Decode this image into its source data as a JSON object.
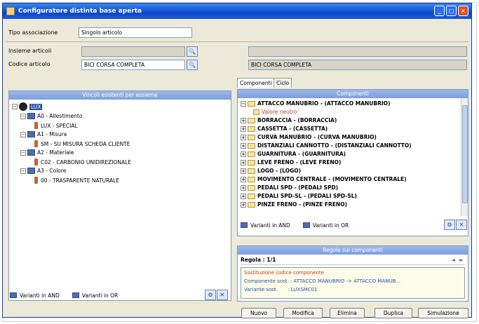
{
  "window": {
    "title": "Configuratore distinta base aperta",
    "buttons": {
      "minimize": "_",
      "maximize": "□",
      "close": "×"
    }
  },
  "top": {
    "tipo_label": "Tipo associazione",
    "tipo_value": "Singolo articolo",
    "insieme_label": "Insieme articoli",
    "insieme_value": "",
    "insieme_desc": "",
    "codice_label": "Codice articolo",
    "codice_value": "BICI CORSA COMPLETA",
    "codice_desc": "BICI CORSA COMPLETA"
  },
  "left_panel": {
    "header": "Vincoli esistenti per assieme",
    "root": "LUX",
    "tree": [
      {
        "text": "A0 - Allestimento",
        "type": "group"
      },
      {
        "text": "LUX - SPECIAL",
        "type": "item"
      },
      {
        "text": "A1 - Misura",
        "type": "group"
      },
      {
        "text": "SM - SU MISURA SCHEDA CLIENTE",
        "type": "item"
      },
      {
        "text": "A2 - Materiale",
        "type": "group"
      },
      {
        "text": "C02 - CARBONIO UNIDIREZIONALE",
        "type": "item"
      },
      {
        "text": "A3 - Colore",
        "type": "group"
      },
      {
        "text": "00 - TRASPARENTE NATURALE",
        "type": "item"
      }
    ],
    "footer_and": "Varianti in AND",
    "footer_or": "Varianti in OR"
  },
  "right_panel": {
    "tabs": [
      "Componenti",
      "Ciclo"
    ],
    "header": "Componenti",
    "valore_neutro": "Valore neutro",
    "components": [
      "ATTACCO MANUBRIO - (ATTACCO MANUBRIO)",
      "BORRACCIA - (BORRACCIA)",
      "CASSETTA - (CASSETTA)",
      "CURVA MANUBRIO - (CURVA MANUBRIO)",
      "DISTANZIALI CANNOTTO - (DISTANZIALI CANNOTTO)",
      "GUARNITURA - (GUARNITURA)",
      "LEVE FRENO - (LEVE FRENO)",
      "LOGO - (LOGO)",
      "MOVIMENTO CENTRALE - (MOVIMENTO CENTRALE)",
      "PEDALI SPD - (PEDALI SPD)",
      "PEDALI SPD-SL - (PEDALI SPD-SL)",
      "PINZE FRENO - (PINZE FRENO)"
    ],
    "footer_and": "Varianti in AND",
    "footer_or": "Varianti in OR",
    "rules_header": "Regole sui componenti",
    "rule_counter": "Regola : 1/1",
    "rule_title": "Sostituzione codice componente",
    "rule_line1_label": "Componente sost. :",
    "rule_line1_value": "ATTACCO MANUBRIO -> ATTACCO MANUB...",
    "rule_line2_label": "Variante sost.",
    "rule_line2_value": ": LUXSMC01"
  },
  "buttons": [
    "Nuovo",
    "Modifica",
    "Elimina",
    "Duplica",
    "Simulazione"
  ]
}
